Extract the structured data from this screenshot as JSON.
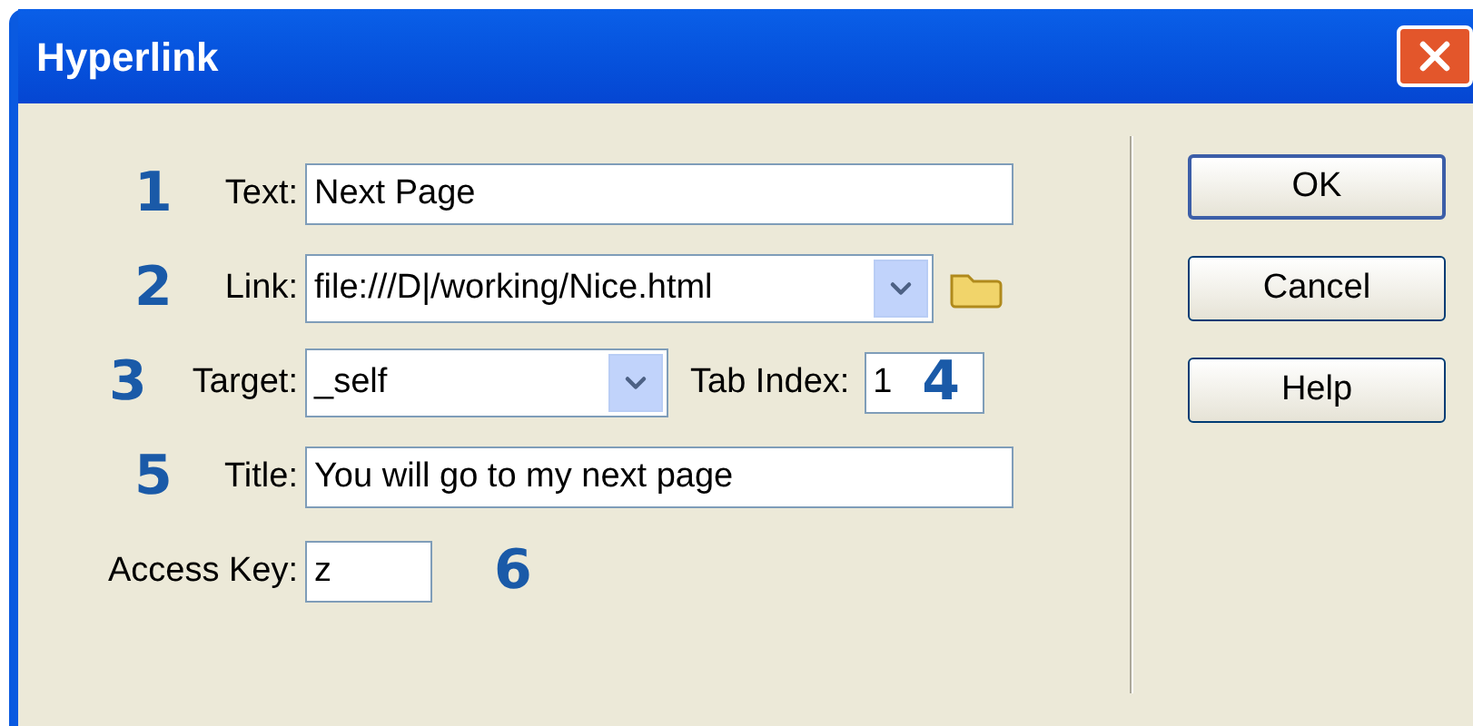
{
  "window": {
    "title": "Hyperlink"
  },
  "form": {
    "text": {
      "marker": "1",
      "label": "Text:",
      "value": "Next Page"
    },
    "link": {
      "marker": "2",
      "label": "Link:",
      "value": "file:///D|/working/Nice.html"
    },
    "target": {
      "marker": "3",
      "label": "Target:",
      "value": "_self"
    },
    "tab_index": {
      "label": "Tab Index:",
      "value": "1",
      "marker": "4"
    },
    "title": {
      "marker": "5",
      "label": "Title:",
      "value": "You will go to my next page"
    },
    "access_key": {
      "label": "Access Key:",
      "value": "z",
      "marker": "6"
    }
  },
  "buttons": [
    {
      "label": "OK",
      "default": true
    },
    {
      "label": "Cancel",
      "default": false
    },
    {
      "label": "Help",
      "default": false
    }
  ]
}
